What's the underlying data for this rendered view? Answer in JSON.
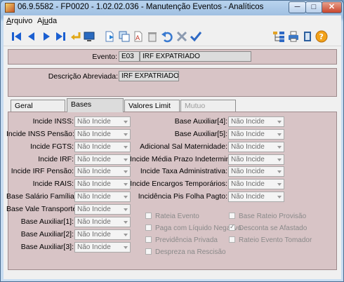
{
  "window": {
    "title": "06.9.5582 - FP0020 - 1.02.02.036 - Manutenção Eventos - Analíticos",
    "minimize_label": "─",
    "maximize_label": "□",
    "close_label": "✕"
  },
  "menubar": {
    "arquivo_prefix": "A",
    "arquivo_rest": "rquivo",
    "ajuda_prefix": "Aj",
    "ajuda_underline": "u",
    "ajuda_rest": "da"
  },
  "toolbar": {
    "icons": [
      "first-record-icon",
      "previous-record-icon",
      "next-record-icon",
      "last-record-icon",
      "confirm-icon",
      "screen-icon",
      "new-document-icon",
      "copy-icon",
      "edit-icon",
      "delete-icon",
      "undo-icon",
      "cancel-icon",
      "check-icon",
      "tree-icon",
      "print-icon",
      "exit-icon",
      "help-icon"
    ]
  },
  "header": {
    "evento_label": "Evento:",
    "evento_code": "E03",
    "evento_name": "IRF EXPATRIADO",
    "descricao_label": "Descrição Abreviada:",
    "descricao_value": "IRF EXPATRIADO"
  },
  "tabs": [
    {
      "label": "Geral"
    },
    {
      "label": "Bases"
    },
    {
      "label": "Valores Limit"
    },
    {
      "label": "Mutuo"
    }
  ],
  "bases_left": [
    {
      "label": "Incide INSS:",
      "value": "Não Incide"
    },
    {
      "label": "Incide INSS Pensão:",
      "value": "Não Incide"
    },
    {
      "label": "Incide FGTS:",
      "value": "Não Incide"
    },
    {
      "label": "Incide IRF:",
      "value": "Não Incide"
    },
    {
      "label": "Incide IRF Pensão:",
      "value": "Não Incide"
    },
    {
      "label": "Incide RAIS:",
      "value": "Não Incide"
    },
    {
      "label": "Base Salário Família:",
      "value": "Não Incide"
    },
    {
      "label": "Base Vale Transporte:",
      "value": "Não Incide"
    },
    {
      "label": "Base Auxiliar[1]:",
      "value": "Não Incide"
    },
    {
      "label": "Base Auxiliar[2]:",
      "value": "Não Incide"
    },
    {
      "label": "Base Auxiliar[3]:",
      "value": "Não Incide"
    }
  ],
  "bases_right": [
    {
      "label": "Base Auxiliar[4]:",
      "value": "Não Incide"
    },
    {
      "label": "Base Auxiliar[5]:",
      "value": "Não Incide"
    },
    {
      "label": "Adicional Sal Maternidade:",
      "value": "Não Incide"
    },
    {
      "label": "Incide Média Prazo Indeterminado:",
      "value": "Não Incide"
    },
    {
      "label": "Incide Taxa Administrativa:",
      "value": "Não Incide"
    },
    {
      "label": "Incide Encargos Temporários:",
      "value": "Não Incide"
    },
    {
      "label": "Incidência Pis Folha Pagto:",
      "value": "Não Incide"
    }
  ],
  "checkboxes_left": [
    {
      "label": "Rateia Evento",
      "checked": false
    },
    {
      "label": "Paga com Líquido Negativo",
      "checked": false
    },
    {
      "label": "Previdência Privada",
      "checked": false
    },
    {
      "label": "Despreza na Rescisão",
      "checked": false
    }
  ],
  "checkboxes_right": [
    {
      "label": "Base Rateio Provisão",
      "checked": false
    },
    {
      "label": "Desconta se Afastado",
      "checked": true
    },
    {
      "label": "Rateio Evento Tomador",
      "checked": false
    }
  ]
}
